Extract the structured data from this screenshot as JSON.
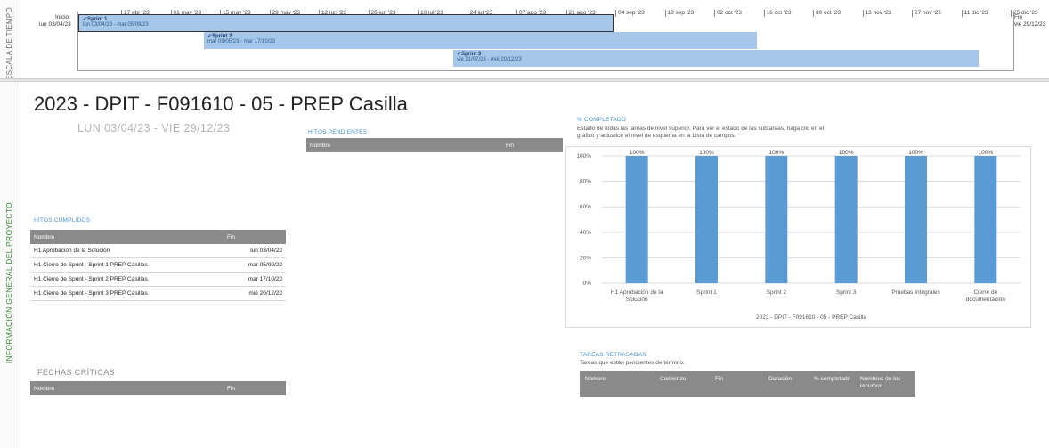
{
  "timeline": {
    "strip_label": "ESCALA DE TIEMPO",
    "start_label": "Inicio",
    "start_date": "lun 03/04/23",
    "end_label": "Fin",
    "end_date": "vie 29/12/23",
    "ticks": [
      "17 abr '23",
      "01 may '23",
      "15 may '23",
      "29 may '23",
      "12 jun '23",
      "26 jun '23",
      "10 jul '23",
      "24 jul '23",
      "07 ago '23",
      "21 ago '23",
      "04 sep '23",
      "18 sep '23",
      "02 oct '23",
      "16 oct '23",
      "30 oct '23",
      "13 nov '23",
      "27 nov '23",
      "11 dic '23",
      "25 dic '23"
    ],
    "sprints": [
      {
        "name": "Sprint 1",
        "range": "lun 03/04/23 - mar 05/09/23"
      },
      {
        "name": "Sprint 2",
        "range": "mar 09/05/23 - mar 17/10/23"
      },
      {
        "name": "Sprint 3",
        "range": "vie 21/07/23 - mié 20/12/23"
      }
    ]
  },
  "side_label": "INFORMACIÓN GENERAL DEL PROYECTO",
  "project": {
    "title": "2023 - DPIT - F091610 - 05 - PREP Casilla",
    "dates": "LUN 03/04/23  -  VIE 29/12/23"
  },
  "hitos_pendientes": {
    "title": "HITOS PENDIENTES",
    "col_name": "Nombre",
    "col_end": "Fin"
  },
  "hitos_cumplidos": {
    "title": "HITOS CUMPLIDOS",
    "col_name": "Nombre",
    "col_end": "Fin",
    "rows": [
      {
        "name": "H1 Aprobación de la Solución",
        "end": "lun 03/04/23"
      },
      {
        "name": "H1 Cierre de Sprint - Sprint 1 PREP Casillas",
        "end": "mar 05/09/23"
      },
      {
        "name": "H1 Cierre de Sprint - Sprint 2 PREP Casillas",
        "end": "mar 17/10/23"
      },
      {
        "name": "H1 Cierre de Sprint  - Sprint 3 PREP Casillas",
        "end": "mié 20/12/23"
      }
    ]
  },
  "fechas_criticas": {
    "title": "FECHAS CRÍTICAS",
    "col_name": "Nombre",
    "col_end": "Fin"
  },
  "completado": {
    "title": "% COMPLETADO",
    "desc1": "Estado de todas las tareas de nivel superior. Para ver el estado de las subtareas, haga clic en el",
    "desc2": "gráfico y actualice el nivel de esquema en la Lista de campos."
  },
  "tareas_retrasadas": {
    "title": "TAREAS RETRASADAS",
    "desc": "Tareas que están pendientes de término.",
    "cols": [
      "Nombre",
      "Comienzo",
      "Fin",
      "Duración",
      "% completado",
      "Nombres de los recursos"
    ]
  },
  "chart_data": {
    "type": "bar",
    "categories": [
      "H1 Aprobación de la Solución",
      "Sprint 1",
      "Sprint 2",
      "Sprint 3",
      "Pruebas Integrales",
      "Cierre de documentación"
    ],
    "values": [
      100,
      100,
      100,
      100,
      100,
      100
    ],
    "data_labels": [
      "100%",
      "100%",
      "100%",
      "100%",
      "100%",
      "100%"
    ],
    "yticks": [
      "0%",
      "20%",
      "40%",
      "60%",
      "80%",
      "100%"
    ],
    "ylim": [
      0,
      100
    ],
    "xlabel": "2023 - DPIT - F091610 - 05 - PREP Casilla",
    "bar_color": "#5b9bd5",
    "grid": true
  }
}
